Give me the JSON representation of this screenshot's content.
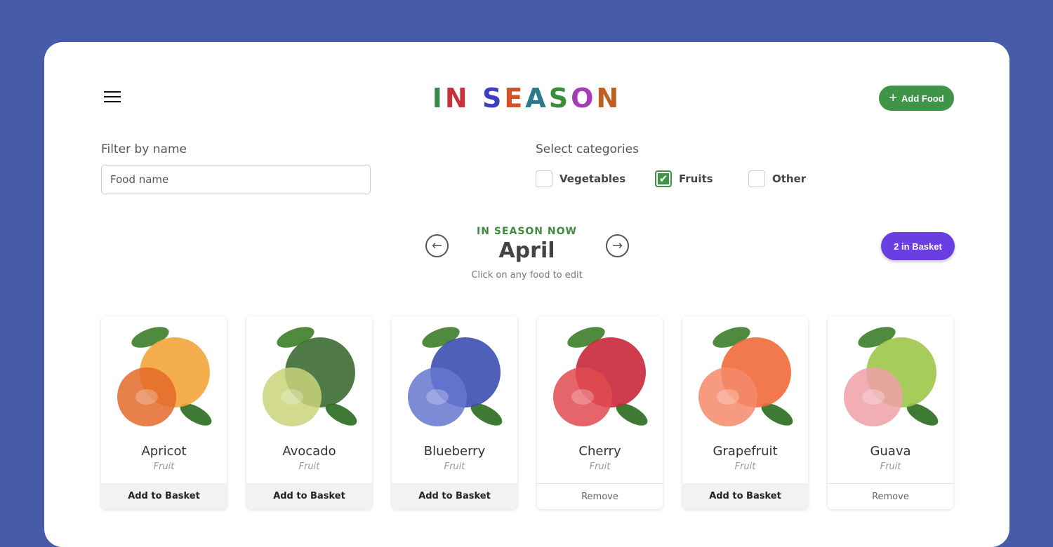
{
  "header": {
    "title_letters": [
      {
        "ch": "I",
        "color": "#3a8a4a"
      },
      {
        "ch": "N",
        "color": "#c8323c"
      },
      {
        "ch": " ",
        "color": "#000"
      },
      {
        "ch": "S",
        "color": "#3b3fc0"
      },
      {
        "ch": "E",
        "color": "#d3502a"
      },
      {
        "ch": "A",
        "color": "#2a7a8c"
      },
      {
        "ch": "S",
        "color": "#3c8d3a"
      },
      {
        "ch": "O",
        "color": "#a63db5"
      },
      {
        "ch": "N",
        "color": "#c0601e"
      }
    ],
    "title": "IN SEASON",
    "add_food": "Add Food",
    "menu_icon": "hamburger-icon"
  },
  "filter": {
    "label": "Filter by name",
    "placeholder": "Food name"
  },
  "categories": {
    "label": "Select categories",
    "items": [
      {
        "label": "Vegetables",
        "checked": false
      },
      {
        "label": "Fruits",
        "checked": true
      },
      {
        "label": "Other",
        "checked": false
      }
    ]
  },
  "season": {
    "kicker": "IN SEASON NOW",
    "month": "April",
    "hint": "Click on any food to edit",
    "prev_icon": "arrow-left-circle-icon",
    "next_icon": "arrow-right-circle-icon"
  },
  "basket": {
    "label": "2 in Basket"
  },
  "foods": [
    {
      "name": "Apricot",
      "type": "Fruit",
      "action": "Add to Basket",
      "in_basket": false,
      "colors": [
        "#f4a53a",
        "#e36a2a"
      ]
    },
    {
      "name": "Avocado",
      "type": "Fruit",
      "action": "Add to Basket",
      "in_basket": false,
      "colors": [
        "#3d6b33",
        "#c9d47a"
      ]
    },
    {
      "name": "Blueberry",
      "type": "Fruit",
      "action": "Add to Basket",
      "in_basket": false,
      "colors": [
        "#3b4fb0",
        "#6677d0"
      ]
    },
    {
      "name": "Cherry",
      "type": "Fruit",
      "action": "Remove",
      "in_basket": true,
      "colors": [
        "#c8283a",
        "#e04a50"
      ]
    },
    {
      "name": "Grapefruit",
      "type": "Fruit",
      "action": "Add to Basket",
      "in_basket": false,
      "colors": [
        "#ef6a3a",
        "#f58a6a"
      ]
    },
    {
      "name": "Guava",
      "type": "Fruit",
      "action": "Remove",
      "in_basket": true,
      "colors": [
        "#9cc84a",
        "#f0a0a8"
      ]
    }
  ]
}
